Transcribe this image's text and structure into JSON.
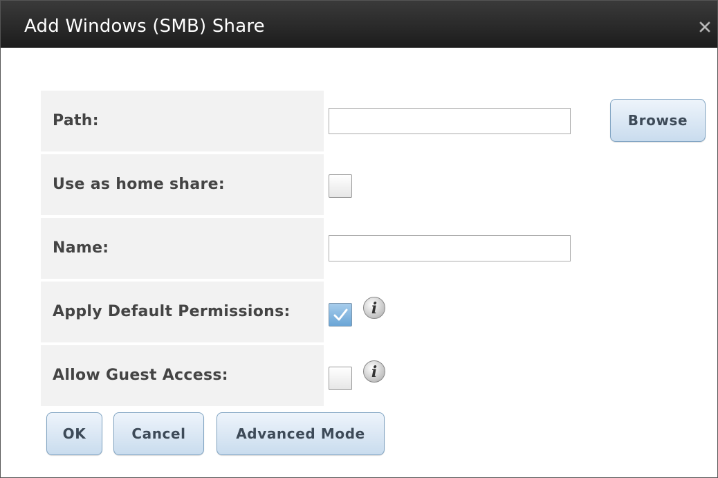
{
  "dialog": {
    "title": "Add Windows (SMB) Share"
  },
  "form": {
    "path_label": "Path:",
    "path_value": "",
    "browse_label": "Browse",
    "home_share_label": "Use as home share:",
    "home_share_checked": false,
    "name_label": "Name:",
    "name_value": "",
    "default_permissions_label": "Apply Default Permissions:",
    "default_permissions_checked": true,
    "guest_access_label": "Allow Guest Access:",
    "guest_access_checked": false
  },
  "buttons": {
    "ok": "OK",
    "cancel": "Cancel",
    "advanced": "Advanced Mode"
  },
  "icons": {
    "close": "close-icon",
    "info": "info-icon"
  },
  "colors": {
    "titlebar": "#1c1c1c",
    "label_bg": "#f2f2f2",
    "button_bg": "#c9dcee",
    "button_border": "#7fa3c2",
    "checkbox_checked": "#6aa5d6"
  }
}
